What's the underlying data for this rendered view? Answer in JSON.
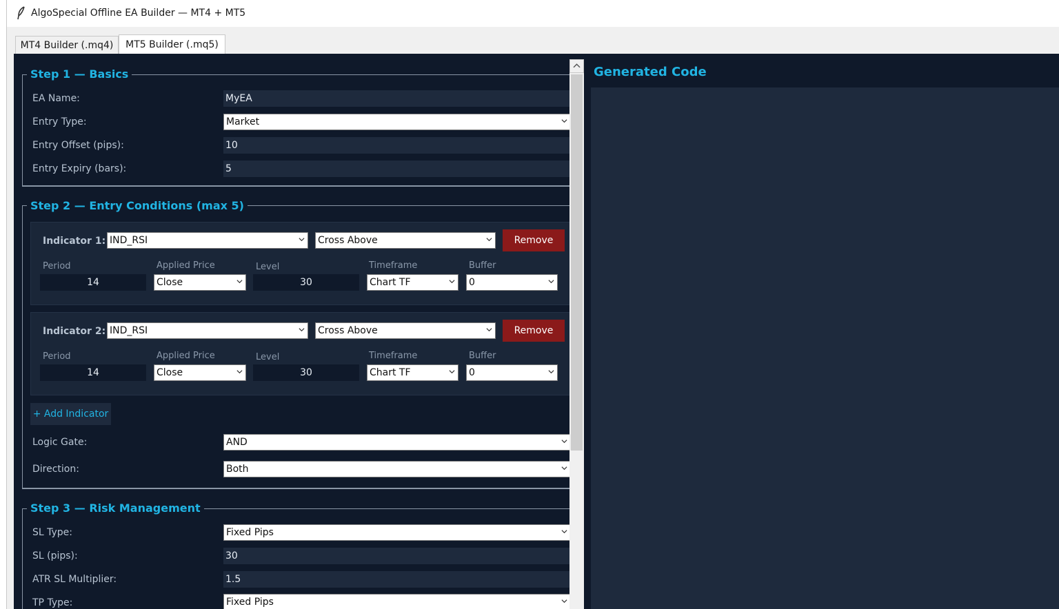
{
  "window": {
    "title": "AlgoSpecial Offline EA Builder — MT4 + MT5",
    "icon": "feather-icon"
  },
  "tabs": [
    {
      "label": "MT4 Builder (.mq4)",
      "selected": false
    },
    {
      "label": "MT5 Builder (.mq5)",
      "selected": true
    }
  ],
  "step1": {
    "legend": "Step 1 — Basics",
    "ea_name_label": "EA Name:",
    "ea_name_value": "MyEA",
    "entry_type_label": "Entry Type:",
    "entry_type_value": "Market",
    "entry_offset_label": "Entry Offset (pips):",
    "entry_offset_value": "10",
    "entry_expiry_label": "Entry Expiry (bars):",
    "entry_expiry_value": "5"
  },
  "step2": {
    "legend": "Step 2 — Entry Conditions (max 5)",
    "indicators": [
      {
        "title": "Indicator 1:",
        "indicator": "IND_RSI",
        "condition": "Cross Above",
        "remove_label": "Remove",
        "period_label": "Period",
        "period": "14",
        "applied_price_label": "Applied Price",
        "applied_price": "Close",
        "level_label": "Level",
        "level": "30",
        "timeframe_label": "Timeframe",
        "timeframe": "Chart TF",
        "buffer_label": "Buffer",
        "buffer": "0"
      },
      {
        "title": "Indicator 2:",
        "indicator": "IND_RSI",
        "condition": "Cross Above",
        "remove_label": "Remove",
        "period_label": "Period",
        "period": "14",
        "applied_price_label": "Applied Price",
        "applied_price": "Close",
        "level_label": "Level",
        "level": "30",
        "timeframe_label": "Timeframe",
        "timeframe": "Chart TF",
        "buffer_label": "Buffer",
        "buffer": "0"
      }
    ],
    "add_indicator_label": "+ Add Indicator",
    "logic_gate_label": "Logic Gate:",
    "logic_gate_value": "AND",
    "direction_label": "Direction:",
    "direction_value": "Both"
  },
  "step3": {
    "legend": "Step 3 — Risk Management",
    "sl_type_label": "SL Type:",
    "sl_type_value": "Fixed Pips",
    "sl_pips_label": "SL (pips):",
    "sl_pips_value": "30",
    "atr_sl_label": "ATR SL Multiplier:",
    "atr_sl_value": "1.5",
    "tp_type_label": "TP Type:",
    "tp_type_value": "Fixed Pips"
  },
  "code_panel": {
    "title": "Generated Code"
  },
  "colors": {
    "background": "#0f192a",
    "accent": "#21b4e3",
    "remove_button": "#8b1a1a",
    "entry_bg": "#1e2a3d"
  }
}
